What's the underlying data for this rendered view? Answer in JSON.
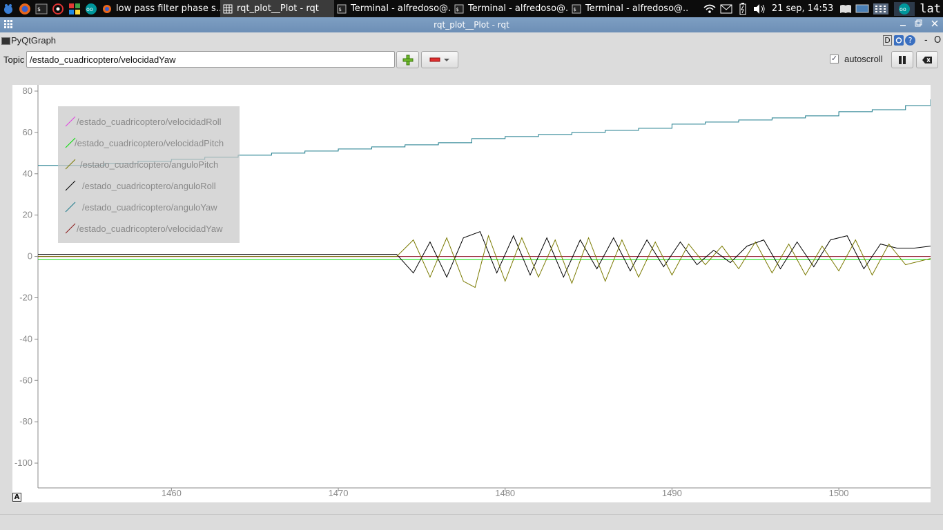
{
  "taskbar": {
    "tasks": [
      {
        "label": "low pass filter phase s...",
        "icon": "firefox-icon"
      },
      {
        "label": "rqt_plot__Plot - rqt",
        "icon": "grid-app-icon"
      },
      {
        "label": "Terminal - alfredoso@...",
        "icon": "terminal-icon"
      },
      {
        "label": "Terminal - alfredoso@...",
        "icon": "terminal-icon"
      },
      {
        "label": "Terminal - alfredoso@...",
        "icon": "terminal-icon"
      }
    ],
    "clock": "21 sep, 14:53",
    "language": "lat"
  },
  "window": {
    "title": "rqt_plot__Plot - rqt"
  },
  "plugin": {
    "name": "PyQtGraph",
    "header_buttons": {
      "d": "D",
      "help": "?",
      "dash": "-",
      "o": "O"
    }
  },
  "toolbar": {
    "topic_label": "Topic",
    "topic_value": "/estado_cuadricoptero/velocidadYaw",
    "autoscroll_label": "autoscroll",
    "autoscroll_checked": true
  },
  "chart_data": {
    "type": "line",
    "xlim": [
      1452,
      1505.5
    ],
    "ylim": [
      -112,
      83
    ],
    "x_ticks": [
      1460,
      1470,
      1480,
      1490,
      1500
    ],
    "y_ticks": [
      80,
      60,
      40,
      20,
      0,
      -20,
      -40,
      -60,
      -80,
      -100
    ],
    "grid": false,
    "legend_position": "top-left",
    "series": [
      {
        "name": "/estado_cuadricoptero/velocidadRoll",
        "color": "#e040e0",
        "x": [
          1452,
          1460,
          1470,
          1473.5,
          1480,
          1490,
          1500,
          1505.5
        ],
        "y": [
          0,
          0,
          0,
          0,
          0,
          0,
          0,
          0
        ]
      },
      {
        "name": "/estado_cuadricoptero/velocidadPitch",
        "color": "#00dd00",
        "x": [
          1452,
          1460,
          1470,
          1480,
          1490,
          1500,
          1505.5
        ],
        "y": [
          -1.5,
          -1.5,
          -1.5,
          -1.5,
          -1.5,
          -1.5,
          -1.5
        ]
      },
      {
        "name": "/estado_cuadricoptero/anguloPitch",
        "color": "#7a7a00",
        "x": [
          1452,
          1473.5,
          1474.5,
          1475.5,
          1476.5,
          1477.5,
          1478.2,
          1479,
          1480,
          1481,
          1482,
          1483,
          1484,
          1485,
          1486,
          1487,
          1488,
          1489,
          1490,
          1491,
          1492,
          1493,
          1494,
          1495,
          1496,
          1497,
          1498,
          1499,
          1500,
          1501,
          1502,
          1503,
          1504,
          1505.5
        ],
        "y": [
          0,
          0,
          8,
          -10,
          9,
          -12,
          -15,
          10,
          -12,
          9,
          -10,
          8,
          -13,
          9,
          -12,
          8,
          -10,
          7,
          -9,
          6,
          -4,
          5,
          -6,
          7,
          -8,
          6,
          -9,
          5,
          -7,
          8,
          -9,
          6,
          -4,
          -1
        ]
      },
      {
        "name": "/estado_cuadricoptero/anguloRoll",
        "color": "#000000",
        "x": [
          1452,
          1473.5,
          1474.5,
          1475.5,
          1476.5,
          1477.5,
          1478.5,
          1479.5,
          1480.5,
          1481.5,
          1482.5,
          1483.5,
          1484.5,
          1485.5,
          1486.5,
          1487.5,
          1488.5,
          1489.5,
          1490.5,
          1491.5,
          1492.5,
          1493.5,
          1494.5,
          1495.5,
          1496.5,
          1497.5,
          1498.5,
          1499.5,
          1500.5,
          1501.5,
          1502.5,
          1503.5,
          1504.5,
          1505.5
        ],
        "y": [
          1,
          1,
          -8,
          7,
          -10,
          9,
          12,
          -8,
          10,
          -9,
          9,
          -10,
          8,
          -6,
          9,
          -7,
          8,
          -5,
          7,
          -4,
          3,
          -3,
          5,
          8,
          -6,
          7,
          -5,
          8,
          10,
          -6,
          6,
          4,
          4,
          5
        ]
      },
      {
        "name": "/estado_cuadricoptero/anguloYaw",
        "color": "#1a7a8a",
        "x": [
          1452,
          1454,
          1456,
          1458,
          1460,
          1462,
          1464,
          1466,
          1468,
          1470,
          1472,
          1474,
          1476,
          1478,
          1480,
          1482,
          1484,
          1486,
          1488,
          1490,
          1492,
          1494,
          1496,
          1498,
          1500,
          1502,
          1504,
          1505.5
        ],
        "y": [
          44,
          44,
          45,
          46,
          47,
          48,
          49,
          50,
          51,
          52,
          53,
          54,
          55,
          57,
          58,
          59,
          60,
          61,
          62,
          64,
          65,
          66,
          67,
          68,
          70,
          71,
          73,
          76
        ]
      },
      {
        "name": "/estado_cuadricoptero/velocidadYaw",
        "color": "#8b1a1a",
        "x": [
          1452,
          1505.5
        ],
        "y": [
          0,
          0
        ]
      }
    ]
  }
}
